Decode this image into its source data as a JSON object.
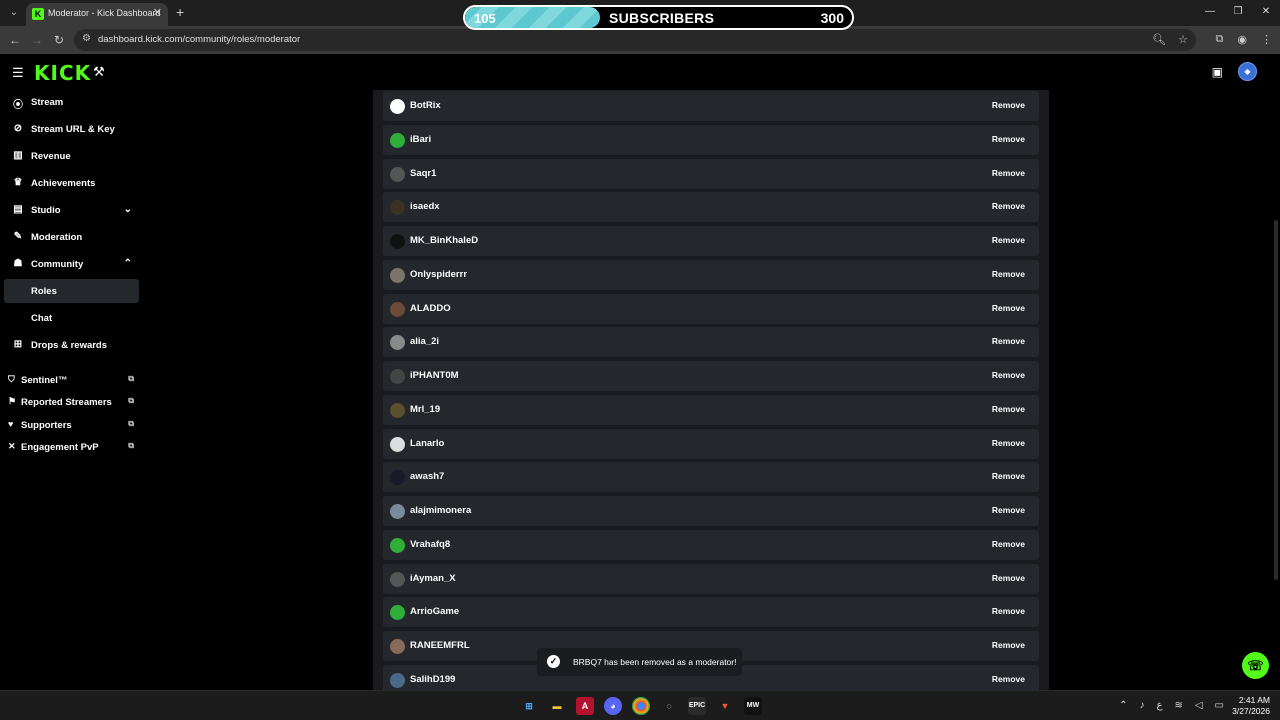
{
  "browser": {
    "tab_title": "Moderator - Kick Dashboard",
    "url": "dashboard.kick.com/community/roles/moderator"
  },
  "subscriber_goal": {
    "current": "105",
    "label": "SUBSCRIBERS",
    "goal": "300",
    "progress": 0.35
  },
  "brand": {
    "logo": "KICK",
    "accent": "#53fc18"
  },
  "sidebar": {
    "items": [
      {
        "label": "Stream",
        "icon": "broadcast-icon"
      },
      {
        "label": "Stream URL & Key",
        "icon": "link-icon"
      },
      {
        "label": "Revenue",
        "icon": "revenue-icon"
      },
      {
        "label": "Achievements",
        "icon": "trophy-icon"
      },
      {
        "label": "Studio",
        "icon": "studio-icon"
      },
      {
        "label": "Moderation",
        "icon": "wrench-icon"
      },
      {
        "label": "Community",
        "icon": "community-icon"
      },
      {
        "label": "Roles",
        "icon": ""
      },
      {
        "label": "Chat",
        "icon": ""
      },
      {
        "label": "Drops & rewards",
        "icon": "gift-icon"
      }
    ],
    "external": [
      {
        "label": "Sentinel™",
        "icon": "shield-icon"
      },
      {
        "label": "Reported Streamers",
        "icon": "flag-icon"
      },
      {
        "label": "Supporters",
        "icon": "heart-icon"
      },
      {
        "label": "Engagement PvP",
        "icon": "swords-icon"
      }
    ]
  },
  "moderators": {
    "remove_label": "Remove",
    "rows": [
      {
        "name": "BotRix"
      },
      {
        "name": "iBari"
      },
      {
        "name": "Saqr1"
      },
      {
        "name": "isaedx"
      },
      {
        "name": "MK_BinKhaleD"
      },
      {
        "name": "Onlyspiderrr"
      },
      {
        "name": "ALADDO"
      },
      {
        "name": "alia_2i"
      },
      {
        "name": "iPHANT0M"
      },
      {
        "name": "Mrl_19"
      },
      {
        "name": "Lanarlo"
      },
      {
        "name": "awash7"
      },
      {
        "name": "alajmimonera"
      },
      {
        "name": "Vrahafq8"
      },
      {
        "name": "iAyman_X"
      },
      {
        "name": "ArrioGame"
      },
      {
        "name": "RANEEMFRL"
      },
      {
        "name": "SalihD199"
      }
    ]
  },
  "toast": {
    "message": "BRBQ7 has been removed as a moderator!"
  },
  "taskbar": {
    "time": "2:41 AM",
    "date": "3/27/2026"
  }
}
